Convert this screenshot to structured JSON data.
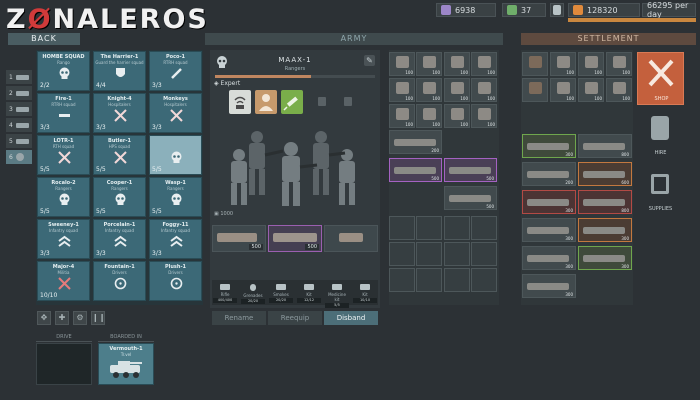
{
  "logo": {
    "prefix": "Z",
    "mark": "Ø",
    "rest": "NALEROS"
  },
  "top_resources": [
    {
      "icon": "population-icon",
      "value": "6938",
      "color": "#9c86c8"
    },
    {
      "icon": "soldiers-icon",
      "value": "37",
      "color": "#6fae6a"
    },
    {
      "icon": "trash-icon",
      "value": "",
      "color": "#b8c3c6"
    },
    {
      "icon": "money-icon",
      "value": "128320",
      "color": "#e08a3c"
    },
    {
      "icon": "income-icon",
      "value": "66295 per day",
      "color": "#d49a5a"
    }
  ],
  "nav": {
    "back": "BACK",
    "army": "ARMY",
    "settlement": "SETTLEMENT"
  },
  "vehicle_tabs": [
    {
      "num": "1"
    },
    {
      "num": "2"
    },
    {
      "num": "3"
    },
    {
      "num": "4"
    },
    {
      "num": "5"
    },
    {
      "num": "6"
    }
  ],
  "squads": [
    {
      "name": "HOMBE SQUAD",
      "rank": "Rango",
      "count": "2/2",
      "badge": "skull-badge-icon"
    },
    {
      "name": "The Harrier-1",
      "rank": "Guard the harrier squad",
      "count": "4/4",
      "badge": "shield-badge-icon"
    },
    {
      "name": "Poco-1",
      "rank": "RTRH squad",
      "count": "3/3",
      "badge": "syringe-badge-icon"
    },
    {
      "name": "Fire-1",
      "rank": "RTRH squad",
      "count": "3/3",
      "badge": "rocket-badge-icon"
    },
    {
      "name": "Knight-4",
      "rank": "Hospitalers",
      "count": "3/3",
      "badge": "cross-swords-badge-icon"
    },
    {
      "name": "Monkeys",
      "rank": "Hospitalers",
      "count": "3/3",
      "badge": "cross-swords-badge-icon"
    },
    {
      "name": "LOTR-1",
      "rank": "RTH squad",
      "count": "5/5",
      "badge": "cross-swords-badge-icon"
    },
    {
      "name": "Butler-1",
      "rank": "HPS squad",
      "count": "5/5",
      "badge": "cross-swords-badge-icon"
    },
    {
      "name": "",
      "rank": "",
      "count": "5/5",
      "badge": "skull-badge-icon"
    },
    {
      "name": "Rocalo-2",
      "rank": "Rangers",
      "count": "5/5",
      "badge": "skull-badge-icon"
    },
    {
      "name": "Cooper-1",
      "rank": "Rangers",
      "count": "5/5",
      "badge": "skull-badge-icon"
    },
    {
      "name": "Wasp-1",
      "rank": "Rangers",
      "count": "5/5",
      "badge": "skull-badge-icon"
    },
    {
      "name": "Sweeney-1",
      "rank": "Infantry squad",
      "count": "3/3",
      "badge": "chevron-badge-icon"
    },
    {
      "name": "Porcelain-1",
      "rank": "Infantry squad",
      "count": "3/3",
      "badge": "chevron-badge-icon"
    },
    {
      "name": "Foggy-11",
      "rank": "Infantry squad",
      "count": "3/3",
      "badge": "chevron-badge-icon"
    },
    {
      "name": "Major-4",
      "rank": "Militia",
      "count": "10/10",
      "badge": "cross-badge-icon"
    },
    {
      "name": "Fountain-1",
      "rank": "Drivers",
      "count": "",
      "badge": "wheel-badge-icon"
    },
    {
      "name": "Plush-1",
      "rank": "Drivers",
      "count": "",
      "badge": "wheel-badge-icon"
    }
  ],
  "drive": {
    "title": "DRIVE"
  },
  "boarded": {
    "title": "BOARDED IN",
    "vehicle_name": "Vermouth-1",
    "vehicle_type": "Tr.vel"
  },
  "detail": {
    "squad_name": "MAAX-1",
    "squad_type": "Rangers",
    "xp_fraction": 0.6,
    "level": "Expert",
    "equip_label": "1000",
    "stats": [
      {
        "label": "Rifle",
        "value": "400/400"
      },
      {
        "label": "Grenades",
        "value": "20/20"
      },
      {
        "label": "Smokes",
        "value": "20/20"
      },
      {
        "label": "Kit",
        "value": "12/12"
      },
      {
        "label": "Medicine kit",
        "value": "5/5"
      },
      {
        "label": "Kit",
        "value": "10/10"
      }
    ],
    "weapons": [
      {
        "level": "500",
        "color": "normal"
      },
      {
        "level": "500",
        "color": "purple"
      },
      {
        "level": "",
        "color": "normal"
      }
    ],
    "actions": {
      "rename": "Rename",
      "reequip": "Reequip",
      "disband": "Disband"
    }
  },
  "inventory_small": [
    {
      "n": "100"
    },
    {
      "n": "100"
    },
    {
      "n": "100"
    },
    {
      "n": "100"
    },
    {
      "n": "100"
    },
    {
      "n": "100"
    },
    {
      "n": "100"
    },
    {
      "n": "100"
    },
    {
      "n": "100"
    },
    {
      "n": "100"
    },
    {
      "n": "100"
    },
    {
      "n": "100"
    }
  ],
  "inventory_long": [
    {
      "n": "200",
      "color": "normal"
    },
    {
      "n": "500",
      "color": "purple"
    },
    {
      "n": "500",
      "color": "purple"
    },
    {
      "n": "500",
      "color": "normal"
    }
  ],
  "settlement_small": [
    {
      "n": "100"
    },
    {
      "n": "100"
    },
    {
      "n": "100"
    },
    {
      "n": "100"
    },
    {
      "n": "100"
    },
    {
      "n": "100"
    }
  ],
  "settlement_long": [
    {
      "n": "300",
      "color": "green"
    },
    {
      "n": "800",
      "color": "normal"
    },
    {
      "n": "200",
      "color": "normal"
    },
    {
      "n": "600",
      "color": "orange"
    },
    {
      "n": "300",
      "color": "red"
    },
    {
      "n": "800",
      "color": "red"
    },
    {
      "n": "300",
      "color": "normal"
    },
    {
      "n": "300",
      "color": "orange"
    },
    {
      "n": "300",
      "color": "normal"
    },
    {
      "n": "300",
      "color": "green"
    },
    {
      "n": "300",
      "color": "normal"
    }
  ],
  "side_buttons": {
    "shop": "SHOP",
    "hire": "HIRE",
    "supplies": "SUPPLIES"
  }
}
